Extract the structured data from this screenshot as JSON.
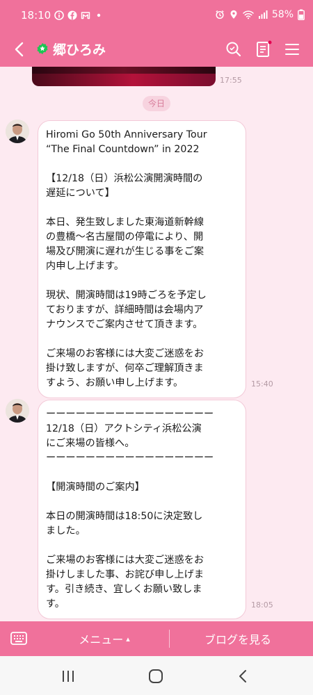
{
  "status_bar": {
    "time": "18:10",
    "battery": "58%",
    "left_icons": [
      "info-icon",
      "facebook-icon",
      "gmail-icon",
      "dot-icon"
    ],
    "right_icons": [
      "alarm-icon",
      "location-icon",
      "wifi-icon",
      "signal-icon",
      "battery-icon"
    ]
  },
  "header": {
    "title": "郷ひろみ",
    "badge": "official-account-badge-icon",
    "accent_color": "#f0719b",
    "buttons": [
      "back-icon",
      "search-icon",
      "notes-icon",
      "menu-icon"
    ]
  },
  "chat": {
    "previous_image_time": "17:55",
    "date_chip": "今日",
    "messages": [
      {
        "time": "15:40",
        "lines": [
          "Hiromi Go 50th Anniversary Tour",
          "“The Final Countdown” in 2022",
          "",
          "【12/18（日）浜松公演開演時間の",
          "遅延について】",
          "",
          "本日、発生致しました東海道新幹線",
          "の豊橋〜名古屋間の停電により、開",
          "場及び開演に遅れが生じる事をご案",
          "内申し上げます。",
          "",
          "現状、開演時間は19時ごろを予定し",
          "ておりますが、詳細時間は会場内ア",
          "ナウンスでご案内させて頂きます。",
          "",
          "ご来場のお客様には大変ご迷惑をお",
          "掛け致しますが、何卒ご理解頂きま",
          "すよう、お願い申し上げます。"
        ]
      },
      {
        "time": "18:05",
        "lines": [
          "ーーーーーーーーーーーーーーーーー",
          "12/18（日）アクトシティ浜松公演",
          "にご来場の皆様へ。",
          "ーーーーーーーーーーーーーーーーー",
          "",
          "【開演時間のご案内】",
          "",
          "本日の開演時間は18:50に決定致し",
          "ました。",
          "",
          "ご来場のお客様には大変ご迷惑をお",
          "掛けしました事、お詫び申し上げま",
          "す。引き続き、宜しくお願い致しま",
          "す。"
        ]
      }
    ]
  },
  "bottom_bar": {
    "menu_label": "メニュー",
    "menu_arrow": "▴",
    "blog_label": "ブログを見る",
    "keyboard_icon": "keyboard-icon"
  },
  "nav_bar": {
    "buttons": [
      "recent-apps-icon",
      "home-icon",
      "back-nav-icon"
    ]
  }
}
